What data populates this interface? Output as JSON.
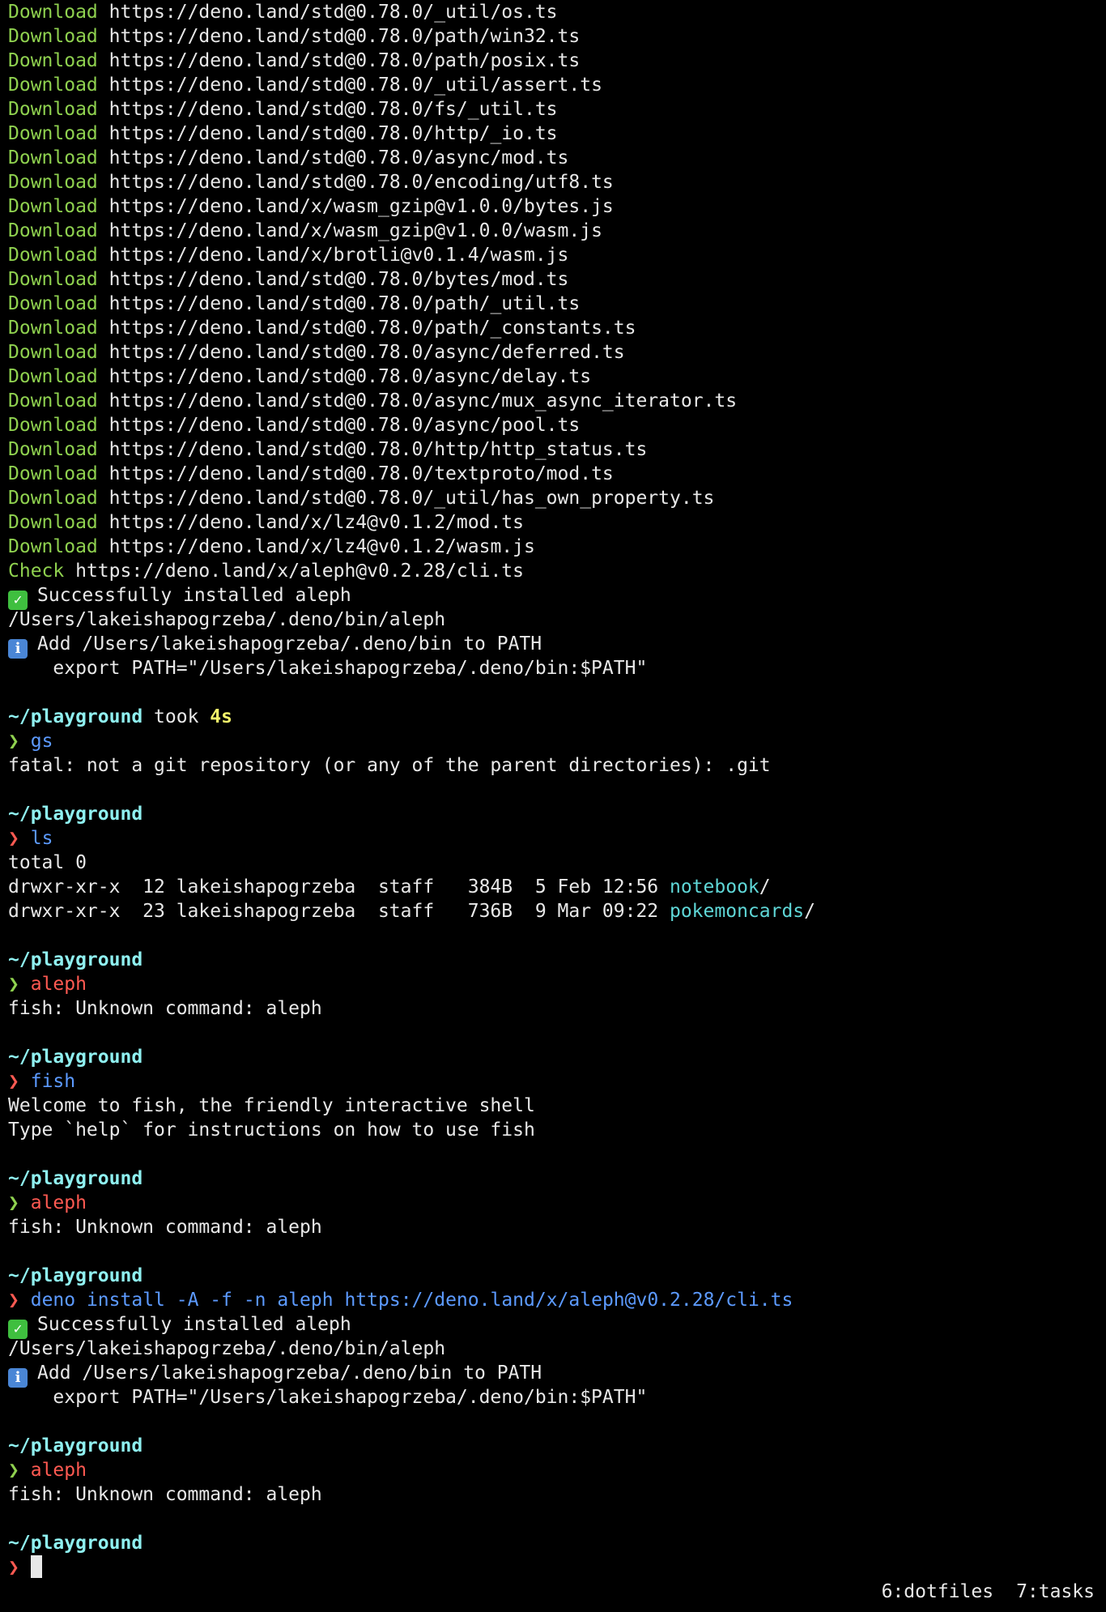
{
  "downloads": [
    "https://deno.land/std@0.78.0/_util/os.ts",
    "https://deno.land/std@0.78.0/path/win32.ts",
    "https://deno.land/std@0.78.0/path/posix.ts",
    "https://deno.land/std@0.78.0/_util/assert.ts",
    "https://deno.land/std@0.78.0/fs/_util.ts",
    "https://deno.land/std@0.78.0/http/_io.ts",
    "https://deno.land/std@0.78.0/async/mod.ts",
    "https://deno.land/std@0.78.0/encoding/utf8.ts",
    "https://deno.land/x/wasm_gzip@v1.0.0/bytes.js",
    "https://deno.land/x/wasm_gzip@v1.0.0/wasm.js",
    "https://deno.land/x/brotli@v0.1.4/wasm.js",
    "https://deno.land/std@0.78.0/bytes/mod.ts",
    "https://deno.land/std@0.78.0/path/_util.ts",
    "https://deno.land/std@0.78.0/path/_constants.ts",
    "https://deno.land/std@0.78.0/async/deferred.ts",
    "https://deno.land/std@0.78.0/async/delay.ts",
    "https://deno.land/std@0.78.0/async/mux_async_iterator.ts",
    "https://deno.land/std@0.78.0/async/pool.ts",
    "https://deno.land/std@0.78.0/http/http_status.ts",
    "https://deno.land/std@0.78.0/textproto/mod.ts",
    "https://deno.land/std@0.78.0/_util/has_own_property.ts",
    "https://deno.land/x/lz4@v0.1.2/mod.ts",
    "https://deno.land/x/lz4@v0.1.2/wasm.js"
  ],
  "labels": {
    "download": "Download",
    "check": "Check",
    "prompt_symbol": "❯",
    "prompt_dir": "~/playground",
    "took": "took",
    "check_icon": "✓",
    "info_icon": "i"
  },
  "lines": {
    "check_url": "https://deno.land/x/aleph@v0.2.28/cli.ts",
    "success1": "Successfully installed aleph",
    "bin_path1": "/Users/lakeishapogrzeba/.deno/bin/aleph",
    "add_path1": "Add /Users/lakeishapogrzeba/.deno/bin to PATH",
    "export1": "    export PATH=\"/Users/lakeishapogrzeba/.deno/bin:$PATH\"",
    "took_time": "4s",
    "cmd_gs": "gs",
    "gs_error": "fatal: not a git repository (or any of the parent directories): .git",
    "cmd_ls": "ls",
    "ls_total": "total 0",
    "ls_row1_meta": "drwxr-xr-x  12 lakeishapogrzeba  staff   384B  5 Feb 12:56 ",
    "ls_row1_name": "notebook",
    "ls_row2_meta": "drwxr-xr-x  23 lakeishapogrzeba  staff   736B  9 Mar 09:22 ",
    "ls_row2_name": "pokemoncards",
    "slash": "/",
    "cmd_aleph": "aleph",
    "aleph_error": "fish: Unknown command: aleph",
    "cmd_fish": "fish",
    "fish_welcome1": "Welcome to fish, the friendly interactive shell",
    "fish_welcome2": "Type `help` for instructions on how to use fish",
    "cmd_deno": "deno",
    "cmd_deno_args": " install -A -f -n aleph ",
    "cmd_deno_url": "https://deno.land/x/aleph@v0.2.28/cli.ts",
    "success2": "Successfully installed aleph",
    "bin_path2": "/Users/lakeishapogrzeba/.deno/bin/aleph",
    "add_path2": "Add /Users/lakeishapogrzeba/.deno/bin to PATH",
    "export2": "    export PATH=\"/Users/lakeishapogrzeba/.deno/bin:$PATH\""
  },
  "statusbar": {
    "item1": "6:dotfiles",
    "item2": "7:tasks"
  },
  "colors": {
    "background": "#000000",
    "download_label": "#8fd14f",
    "prompt_dir": "#8ff0f0",
    "directory": "#5fd7d7",
    "valid_command": "#5c9aff",
    "invalid_command": "#ff5a52",
    "took_time": "#f5f56b"
  }
}
